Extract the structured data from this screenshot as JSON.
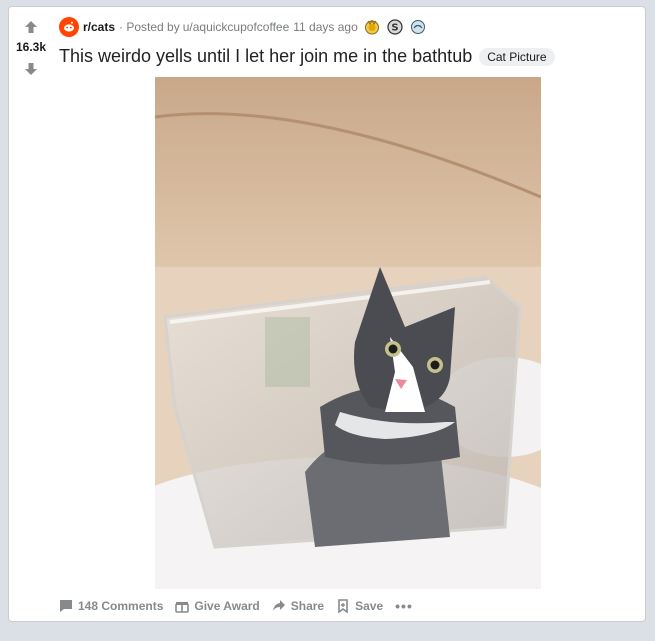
{
  "post": {
    "subreddit": "r/cats",
    "posted_by_prefix": "· Posted by",
    "author": "u/aquickcupofcoffee",
    "time_ago": "11 days ago",
    "score": "16.3k",
    "title": "This weirdo yells until I let her join me in the bathtub",
    "flair": "Cat Picture",
    "awards": [
      "gold-award-icon",
      "silver-award-icon",
      "hugz-award-icon"
    ]
  },
  "actions": {
    "comments_label": "148 Comments",
    "give_award_label": "Give Award",
    "share_label": "Share",
    "save_label": "Save",
    "more_label": "•••"
  },
  "colors": {
    "background": "#dae0e6",
    "card": "#ffffff",
    "meta_text": "#787c7e",
    "action_text": "#878a8c",
    "subreddit_icon": "#ff4500",
    "flair_bg": "#edeff1"
  }
}
